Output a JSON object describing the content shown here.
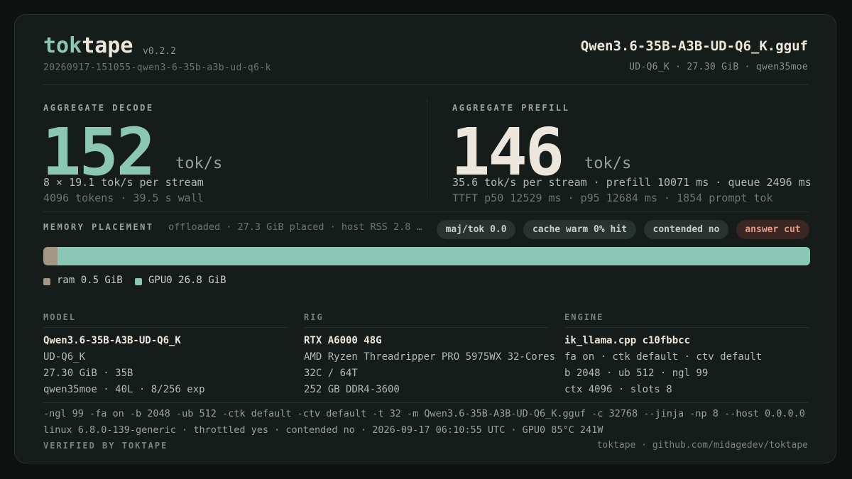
{
  "header": {
    "brand_tok": "tok",
    "brand_tape": "tape",
    "version": "v0.2.2",
    "run_id": "20260917-151055-qwen3-6-35b-a3b-ud-q6-k",
    "model_file": "Qwen3.6-35B-A3B-UD-Q6_K.gguf",
    "model_meta": "UD-Q6_K · 27.30 GiB · qwen35moe"
  },
  "decode": {
    "label": "AGGREGATE DECODE",
    "value": "152",
    "unit": "tok/s",
    "line1": "8 × 19.1 tok/s per stream",
    "line2": "4096 tokens · 39.5 s wall"
  },
  "prefill": {
    "label": "AGGREGATE PREFILL",
    "value": "146",
    "unit": "tok/s",
    "line1": "35.6 tok/s per stream · prefill 10071 ms · queue 2496 ms",
    "line2": "TTFT p50 12529 ms · p95 12684 ms · 1854 prompt tok"
  },
  "memory": {
    "label": "MEMORY PLACEMENT",
    "desc": "offloaded · 27.3 GiB placed · host RSS 2.8 …",
    "pills": [
      {
        "text": "maj/tok 0.0",
        "warn": false
      },
      {
        "text": "cache warm 0% hit",
        "warn": false
      },
      {
        "text": "contended no",
        "warn": false
      },
      {
        "text": "answer cut",
        "warn": true
      }
    ],
    "segments": [
      {
        "name": "ram",
        "gib": 0.5,
        "label": "ram 0.5 GiB",
        "color": "#a39783"
      },
      {
        "name": "GPU0",
        "gib": 26.8,
        "label": "GPU0 26.8 GiB",
        "color": "#8cc7b5"
      }
    ]
  },
  "model_section": {
    "label": "MODEL",
    "head": "Qwen3.6-35B-A3B-UD-Q6_K",
    "lines": [
      "UD-Q6_K",
      "27.30 GiB · 35B",
      "qwen35moe · 40L · 8/256 exp"
    ]
  },
  "rig_section": {
    "label": "RIG",
    "head": "RTX A6000 48G",
    "lines": [
      "AMD Ryzen Threadripper PRO 5975WX 32-Cores",
      "32C / 64T",
      "252 GB DDR4-3600"
    ]
  },
  "engine_section": {
    "label": "ENGINE",
    "head": "ik_llama.cpp c10fbbcc",
    "lines": [
      "fa on · ctk default · ctv default",
      "b 2048 · ub 512 · ngl 99",
      "ctx 4096 · slots 8"
    ]
  },
  "footer": {
    "command": "-ngl 99  -fa on  -b 2048  -ub 512  -ctk default  -ctv default  -t 32  -m Qwen3.6-35B-A3B-UD-Q6_K.gguf  -c 32768  --jinja  -np 8  --host 0.0.0.0",
    "system": "linux 6.8.0-139-generic · throttled yes · contended no · 2026-09-17 06:10:55 UTC · GPU0 85°C 241W",
    "verified": "VERIFIED BY TOKTAPE",
    "link": "toktape · github.com/midagedev/toktape"
  }
}
